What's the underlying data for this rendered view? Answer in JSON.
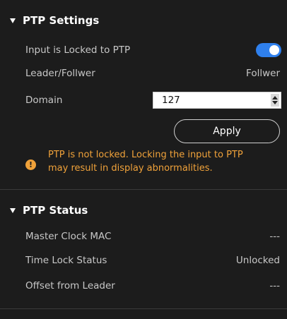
{
  "colors": {
    "panel_bg": "#1c1c1c",
    "accent_toggle": "#2f80ed",
    "warning": "#f0a23a",
    "text_dim": "#c8c8c8",
    "text_bright": "#ffffff"
  },
  "ptp_settings": {
    "title": "PTP Settings",
    "input_locked_label": "Input is Locked to PTP",
    "input_locked_on": true,
    "leader_label": "Leader/Follwer",
    "leader_value": "Follwer",
    "domain_label": "Domain",
    "domain_value": "127",
    "apply_label": "Apply",
    "warning_icon": "warning-icon",
    "warning_line1": "PTP is not locked. Locking the input to PTP",
    "warning_line2": "may result in display abnormalities."
  },
  "ptp_status": {
    "title": "PTP Status",
    "master_mac_label": "Master Clock MAC",
    "master_mac_value": "---",
    "time_lock_label": "Time Lock Status",
    "time_lock_value": "Unlocked",
    "offset_label": "Offset from Leader",
    "offset_value": "---"
  }
}
